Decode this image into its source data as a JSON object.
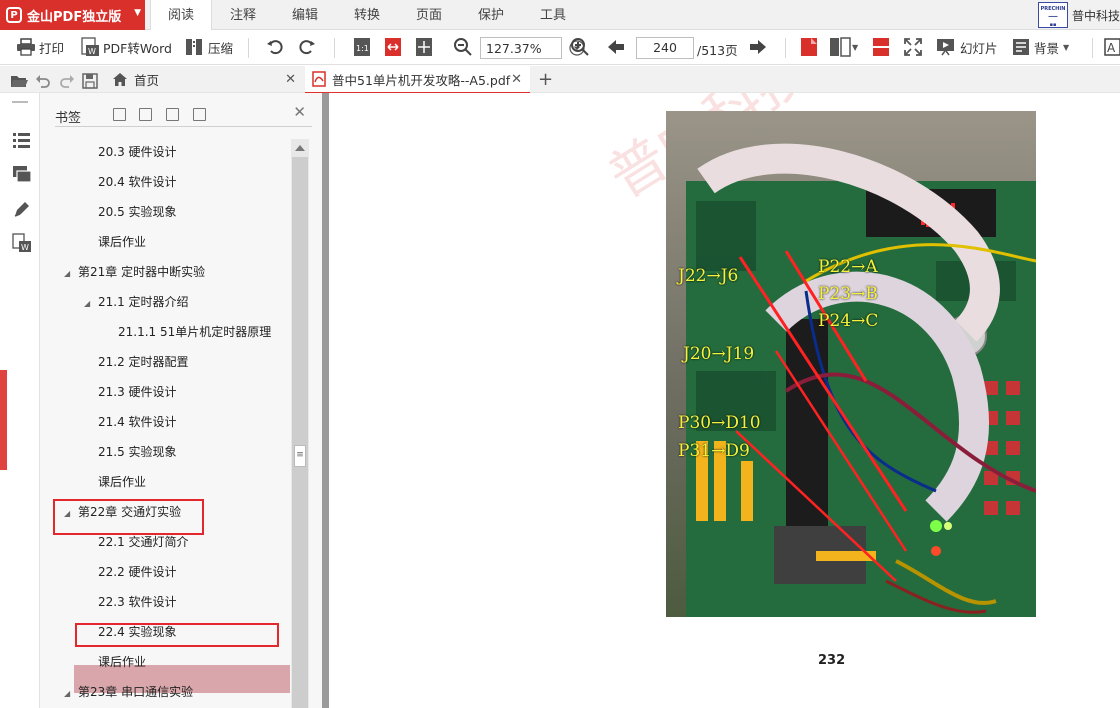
{
  "app": {
    "brand": "金山PDF独立版",
    "menu_tabs": [
      "阅读",
      "注释",
      "编辑",
      "转换",
      "页面",
      "保护",
      "工具"
    ],
    "active_menu_tab": "阅读",
    "company": "普中科技"
  },
  "toolbar": {
    "print": "打印",
    "pdf_to_word": "PDF转Word",
    "compress": "压缩",
    "zoom": "127.37%",
    "current_page": "240",
    "total_pages": "/513页",
    "slideshow": "幻灯片",
    "background": "背景"
  },
  "tabs": {
    "home": "首页",
    "document": "普中51单片机开发攻略--A5.pdf"
  },
  "bookmarks": {
    "title": "书签",
    "items": [
      {
        "label": "20.3 硬件设计",
        "level": 2,
        "arrow": ""
      },
      {
        "label": "20.4 软件设计",
        "level": 2,
        "arrow": ""
      },
      {
        "label": "20.5 实验现象",
        "level": 2,
        "arrow": ""
      },
      {
        "label": "课后作业",
        "level": 2,
        "arrow": ""
      },
      {
        "label": "第21章 定时器中断实验",
        "level": 1,
        "arrow": "◢"
      },
      {
        "label": "21.1 定时器介绍",
        "level": 2,
        "arrow": "◢"
      },
      {
        "label": "21.1.1 51单片机定时器原理",
        "level": 3,
        "arrow": ""
      },
      {
        "label": "21.2 定时器配置",
        "level": 2,
        "arrow": ""
      },
      {
        "label": "21.3 硬件设计",
        "level": 2,
        "arrow": ""
      },
      {
        "label": "21.4 软件设计",
        "level": 2,
        "arrow": ""
      },
      {
        "label": "21.5 实验现象",
        "level": 2,
        "arrow": ""
      },
      {
        "label": "课后作业",
        "level": 2,
        "arrow": ""
      },
      {
        "label": "第22章 交通灯实验",
        "level": 1,
        "arrow": "◢"
      },
      {
        "label": "22.1 交通灯简介",
        "level": 2,
        "arrow": ""
      },
      {
        "label": "22.2 硬件设计",
        "level": 2,
        "arrow": ""
      },
      {
        "label": "22.3 软件设计",
        "level": 2,
        "arrow": ""
      },
      {
        "label": "22.4 实验现象",
        "level": 2,
        "arrow": ""
      },
      {
        "label": "课后作业",
        "level": 2,
        "arrow": ""
      },
      {
        "label": "第23章 串口通信实验",
        "level": 1,
        "arrow": "◢"
      }
    ],
    "selected": "22.4 实验现象"
  },
  "document": {
    "watermark": "普中科技",
    "photo_labels": [
      "J22→J6",
      "P22→A",
      "P23→B",
      "P24→C",
      "J20→J19",
      "P30→D10",
      "P31→D9"
    ],
    "page_number": "232"
  }
}
